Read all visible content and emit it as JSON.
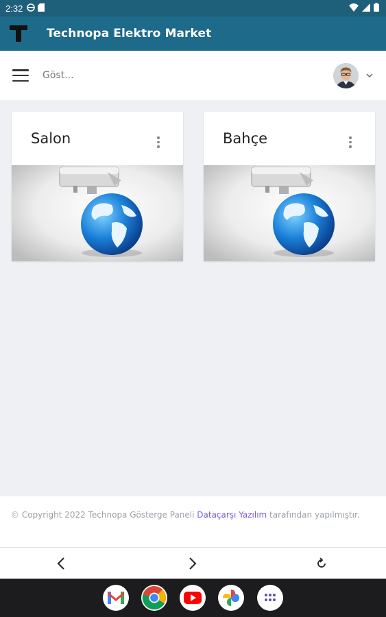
{
  "status_bar": {
    "time": "2:32"
  },
  "app_bar": {
    "logo_letter": "T",
    "title": "Technopa Elektro Market"
  },
  "toolbar": {
    "search_placeholder": "Göst..."
  },
  "cards": [
    {
      "title": "Salon"
    },
    {
      "title": "Bahçe"
    }
  ],
  "footer": {
    "prefix": "© Copyright 2022 Technopa Gösterge Paneli ",
    "link": "Dataçarşı Yazılım",
    "suffix": " tarafından yapılmıştır."
  },
  "nav": {
    "back_icon": "chevron-left-icon",
    "forward_icon": "chevron-right-icon",
    "reload_icon": "reload-icon"
  },
  "dock": {
    "apps": [
      "gmail-icon",
      "chrome-icon",
      "youtube-icon",
      "photos-icon",
      "app-drawer-icon"
    ]
  },
  "colors": {
    "statusbar": "#1e5f7a",
    "appbar": "#1e6a8a",
    "background": "#eef0f4",
    "link": "#7a5be6"
  }
}
